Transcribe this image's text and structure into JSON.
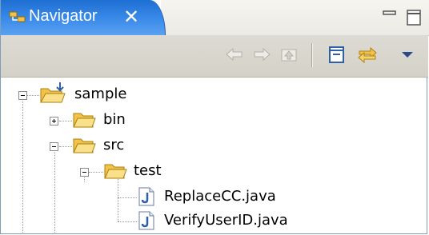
{
  "view": {
    "title": "Navigator",
    "title_icon": "navigator-icon",
    "close_icon": "close-icon"
  },
  "window_controls": [
    {
      "name": "minimize-icon"
    },
    {
      "name": "maximize-icon"
    }
  ],
  "toolbar": {
    "buttons": [
      {
        "name": "back-arrow-icon",
        "enabled": false
      },
      {
        "name": "forward-arrow-icon",
        "enabled": false
      },
      {
        "name": "go-up-icon",
        "enabled": false
      },
      {
        "name": "collapse-all-icon",
        "enabled": true
      },
      {
        "name": "link-with-editor-icon",
        "enabled": true
      },
      {
        "name": "view-menu-chevron-icon",
        "enabled": true
      }
    ]
  },
  "tree": {
    "nodes": [
      {
        "label": "sample",
        "type": "project-folder",
        "expanded": true,
        "depth": 0
      },
      {
        "label": "bin",
        "type": "folder",
        "expanded": false,
        "depth": 1
      },
      {
        "label": "src",
        "type": "folder",
        "expanded": true,
        "depth": 1
      },
      {
        "label": "test",
        "type": "folder",
        "expanded": true,
        "depth": 2
      },
      {
        "label": "ReplaceCC.java",
        "type": "java-file",
        "depth": 3
      },
      {
        "label": "VerifyUserID.java",
        "type": "java-file",
        "depth": 3
      }
    ]
  },
  "colors": {
    "tab_active": "#3b8bea",
    "folder": "#f3c24a",
    "java_icon": "#2f5fa8",
    "toolbar_bg": "#d8d6cd"
  }
}
